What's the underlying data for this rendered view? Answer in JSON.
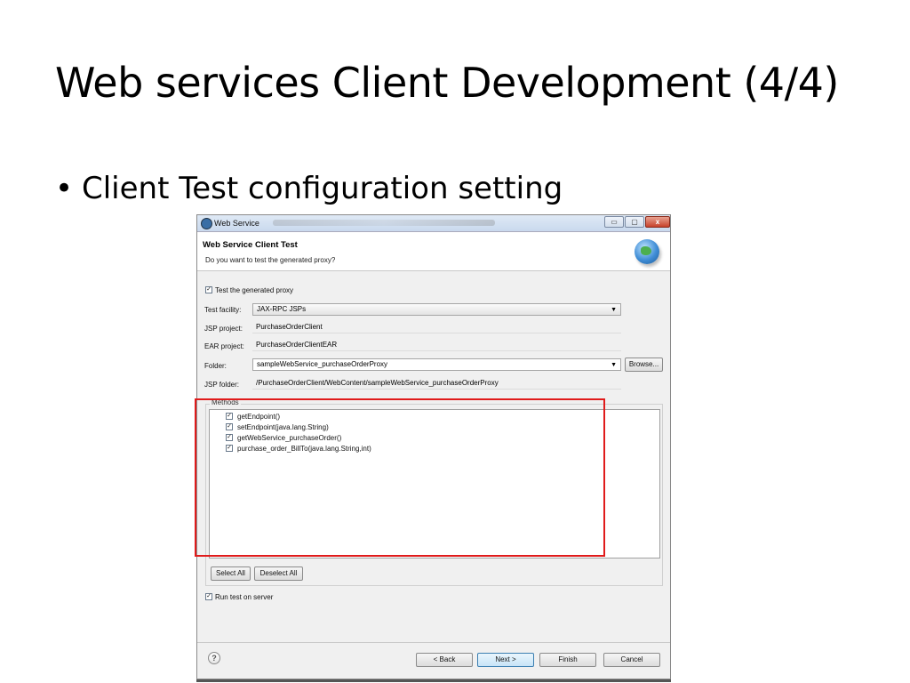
{
  "slide": {
    "title": "Web services Client Development (4/4)",
    "bullet": "Client Test configuration setting",
    "bullet_mark": "•"
  },
  "window": {
    "title": "Web Service",
    "min_symbol": "▭",
    "max_symbol": "▢",
    "close_symbol": "x"
  },
  "header": {
    "title": "Web Service Client Test",
    "subtitle": "Do you want to test the generated proxy?",
    "icon": "globe-icon"
  },
  "form": {
    "test_proxy": {
      "label": "Test the generated proxy",
      "checked": true
    },
    "test_facility": {
      "label": "Test facility:",
      "value": "JAX-RPC JSPs"
    },
    "jsp_project": {
      "label": "JSP project:",
      "value": "PurchaseOrderClient"
    },
    "ear_project": {
      "label": "EAR project:",
      "value": "PurchaseOrderClientEAR"
    },
    "folder": {
      "label": "Folder:",
      "value": "sampleWebService_purchaseOrderProxy",
      "browse": "Browse..."
    },
    "jsp_folder": {
      "label": "JSP folder:",
      "value": "/PurchaseOrderClient/WebContent/sampleWebService_purchaseOrderProxy"
    }
  },
  "methods": {
    "legend": "Methods",
    "items": [
      {
        "label": "getEndpoint()",
        "checked": true
      },
      {
        "label": "setEndpoint(java.lang.String)",
        "checked": true
      },
      {
        "label": "getWebService_purchaseOrder()",
        "checked": true
      },
      {
        "label": "purchase_order_BillTo(java.lang.String,int)",
        "checked": true
      }
    ],
    "select_all": "Select All",
    "deselect_all": "Deselect All"
  },
  "run_test": {
    "label": "Run test on server",
    "checked": true
  },
  "check_mark": "✓",
  "footer": {
    "help": "?",
    "back": "< Back",
    "next": "Next >",
    "finish": "Finish",
    "cancel": "Cancel"
  },
  "colors": {
    "highlight": "#e01b1b",
    "default_button": "#3c7fb1"
  }
}
